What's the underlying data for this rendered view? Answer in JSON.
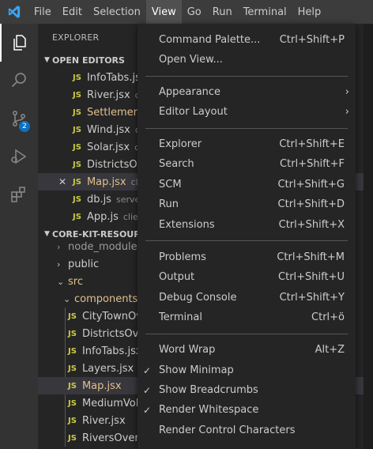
{
  "menubar": {
    "items": [
      "File",
      "Edit",
      "Selection",
      "View",
      "Go",
      "Run",
      "Terminal",
      "Help"
    ],
    "active": "View"
  },
  "activity": {
    "scm_badge": "2"
  },
  "explorer": {
    "title": "EXPLORER",
    "open_editors_title": "OPEN EDITORS",
    "open_editors": [
      {
        "name": "InfoTabs.jsx",
        "dir": ""
      },
      {
        "name": "River.jsx",
        "dir": "cli"
      },
      {
        "name": "Settlement...",
        "dir": ""
      },
      {
        "name": "Wind.jsx",
        "dir": "cli"
      },
      {
        "name": "Solar.jsx",
        "dir": "cli"
      },
      {
        "name": "DistrictsOve...",
        "dir": ""
      },
      {
        "name": "Map.jsx",
        "dir": "clie"
      },
      {
        "name": "db.js",
        "dir": "server"
      },
      {
        "name": "App.js",
        "dir": "client"
      }
    ],
    "project_title": "CORE-KIT-RESOURCE",
    "tree": {
      "node_modules": "node_modules",
      "public": "public",
      "src": "src",
      "components": "components",
      "files": [
        "CityTownOve...",
        "DistrictsOver...",
        "InfoTabs.jsx",
        "Layers.jsx",
        "Map.jsx",
        "MediumVolt...",
        "River.jsx",
        "RiversOverla..."
      ]
    }
  },
  "view_menu": {
    "groups": [
      [
        {
          "label": "Command Palette...",
          "shortcut": "Ctrl+Shift+P"
        },
        {
          "label": "Open View...",
          "shortcut": ""
        }
      ],
      [
        {
          "label": "Appearance",
          "submenu": true
        },
        {
          "label": "Editor Layout",
          "submenu": true
        }
      ],
      [
        {
          "label": "Explorer",
          "shortcut": "Ctrl+Shift+E"
        },
        {
          "label": "Search",
          "shortcut": "Ctrl+Shift+F"
        },
        {
          "label": "SCM",
          "shortcut": "Ctrl+Shift+G"
        },
        {
          "label": "Run",
          "shortcut": "Ctrl+Shift+D"
        },
        {
          "label": "Extensions",
          "shortcut": "Ctrl+Shift+X"
        }
      ],
      [
        {
          "label": "Problems",
          "shortcut": "Ctrl+Shift+M"
        },
        {
          "label": "Output",
          "shortcut": "Ctrl+Shift+U"
        },
        {
          "label": "Debug Console",
          "shortcut": "Ctrl+Shift+Y"
        },
        {
          "label": "Terminal",
          "shortcut": "Ctrl+ö"
        }
      ],
      [
        {
          "label": "Word Wrap",
          "shortcut": "Alt+Z"
        },
        {
          "label": "Show Minimap",
          "checked": true
        },
        {
          "label": "Show Breadcrumbs",
          "checked": true
        },
        {
          "label": "Render Whitespace",
          "checked": true
        },
        {
          "label": "Render Control Characters"
        }
      ]
    ],
    "check_glyph": "✓",
    "arrow_glyph": "›"
  },
  "colors": {
    "accent_blue": "#0e70c0",
    "js_yellow": "#cbcb41",
    "modified": "#e2c08d"
  }
}
